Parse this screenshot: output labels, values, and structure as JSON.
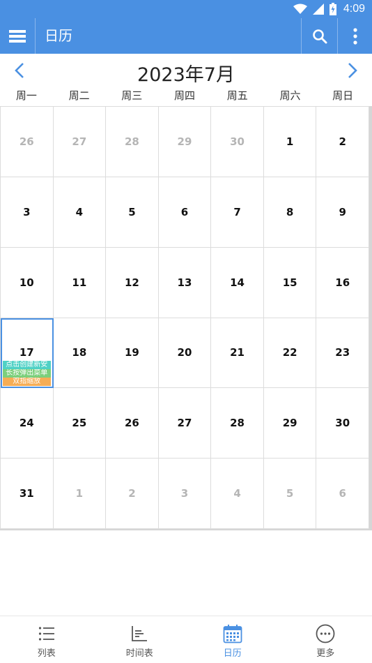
{
  "status": {
    "time": "4:09"
  },
  "appbar": {
    "title": "日历"
  },
  "calendar": {
    "month_title": "2023年7月",
    "weekdays": [
      "周一",
      "周二",
      "周三",
      "周四",
      "周五",
      "周六",
      "周日"
    ],
    "days": [
      {
        "num": "26",
        "in_month": false
      },
      {
        "num": "27",
        "in_month": false
      },
      {
        "num": "28",
        "in_month": false
      },
      {
        "num": "29",
        "in_month": false
      },
      {
        "num": "30",
        "in_month": false
      },
      {
        "num": "1",
        "in_month": true
      },
      {
        "num": "2",
        "in_month": true
      },
      {
        "num": "3",
        "in_month": true
      },
      {
        "num": "4",
        "in_month": true
      },
      {
        "num": "5",
        "in_month": true
      },
      {
        "num": "6",
        "in_month": true
      },
      {
        "num": "7",
        "in_month": true
      },
      {
        "num": "8",
        "in_month": true
      },
      {
        "num": "9",
        "in_month": true
      },
      {
        "num": "10",
        "in_month": true
      },
      {
        "num": "11",
        "in_month": true
      },
      {
        "num": "12",
        "in_month": true
      },
      {
        "num": "13",
        "in_month": true
      },
      {
        "num": "14",
        "in_month": true
      },
      {
        "num": "15",
        "in_month": true
      },
      {
        "num": "16",
        "in_month": true
      },
      {
        "num": "17",
        "in_month": true,
        "today": true
      },
      {
        "num": "18",
        "in_month": true
      },
      {
        "num": "19",
        "in_month": true
      },
      {
        "num": "20",
        "in_month": true
      },
      {
        "num": "21",
        "in_month": true
      },
      {
        "num": "22",
        "in_month": true
      },
      {
        "num": "23",
        "in_month": true
      },
      {
        "num": "24",
        "in_month": true
      },
      {
        "num": "25",
        "in_month": true
      },
      {
        "num": "26",
        "in_month": true
      },
      {
        "num": "27",
        "in_month": true
      },
      {
        "num": "28",
        "in_month": true
      },
      {
        "num": "29",
        "in_month": true
      },
      {
        "num": "30",
        "in_month": true
      },
      {
        "num": "31",
        "in_month": true
      },
      {
        "num": "1",
        "in_month": false
      },
      {
        "num": "2",
        "in_month": false
      },
      {
        "num": "3",
        "in_month": false
      },
      {
        "num": "4",
        "in_month": false
      },
      {
        "num": "5",
        "in_month": false
      },
      {
        "num": "6",
        "in_month": false
      }
    ],
    "today_tips": [
      {
        "text": "点击创建新安",
        "color": "#4fd1c5"
      },
      {
        "text": "长按弹出菜单",
        "color": "#7ccf7c"
      },
      {
        "text": "双指缩放",
        "color": "#f6ad55"
      }
    ]
  },
  "bottom_nav": [
    {
      "label": "列表",
      "icon": "list-icon",
      "active": false
    },
    {
      "label": "时间表",
      "icon": "timeline-icon",
      "active": false
    },
    {
      "label": "日历",
      "icon": "calendar-icon",
      "active": true
    },
    {
      "label": "更多",
      "icon": "more-circle-icon",
      "active": false
    }
  ],
  "colors": {
    "primary": "#4a90e2",
    "other_month_text": "#b5b5b5",
    "grid_line": "#dcdcdc"
  }
}
